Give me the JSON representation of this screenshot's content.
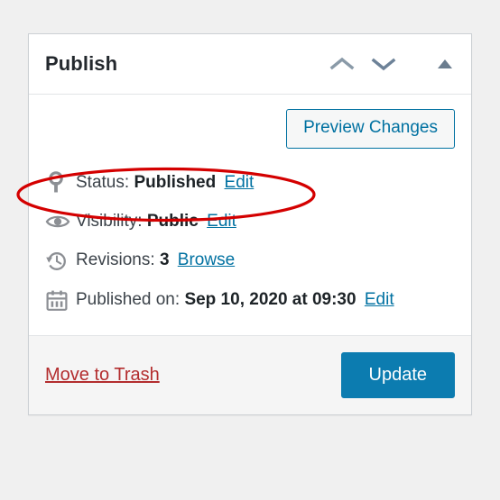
{
  "panel": {
    "title": "Publish",
    "header_icons": [
      {
        "name": "chevron-up-icon",
        "label": "Move up"
      },
      {
        "name": "chevron-down-icon",
        "label": "Move down"
      },
      {
        "name": "triangle-up-icon",
        "label": "Toggle panel"
      }
    ],
    "preview_button": "Preview Changes",
    "rows": [
      {
        "icon": "post-status-pin-icon",
        "label": "Status:",
        "value": "Published",
        "link": "Edit"
      },
      {
        "icon": "eye-icon",
        "label": "Visibility:",
        "value": "Public",
        "link": "Edit"
      },
      {
        "icon": "backup-clock-icon",
        "label": "Revisions:",
        "value": "3",
        "link": "Browse"
      },
      {
        "icon": "calendar-icon",
        "label": "Published on:",
        "value": "Sep 10, 2020 at 09:30",
        "link": "Edit"
      }
    ],
    "footer": {
      "trash_label": "Move to Trash",
      "update_label": "Update"
    }
  },
  "annotation": {
    "shape": "ellipse",
    "target": "status-row",
    "color": "#d40000"
  },
  "colors": {
    "accent_blue": "#0071a1",
    "button_blue": "#0c7cb0",
    "trash_red": "#b32d2e",
    "annotation_red": "#d40000",
    "page_background": "#f0f0f0",
    "footer_background": "#f5f5f5",
    "panel_border": "#ccd0d4",
    "icon_gray": "#8c8f94"
  }
}
